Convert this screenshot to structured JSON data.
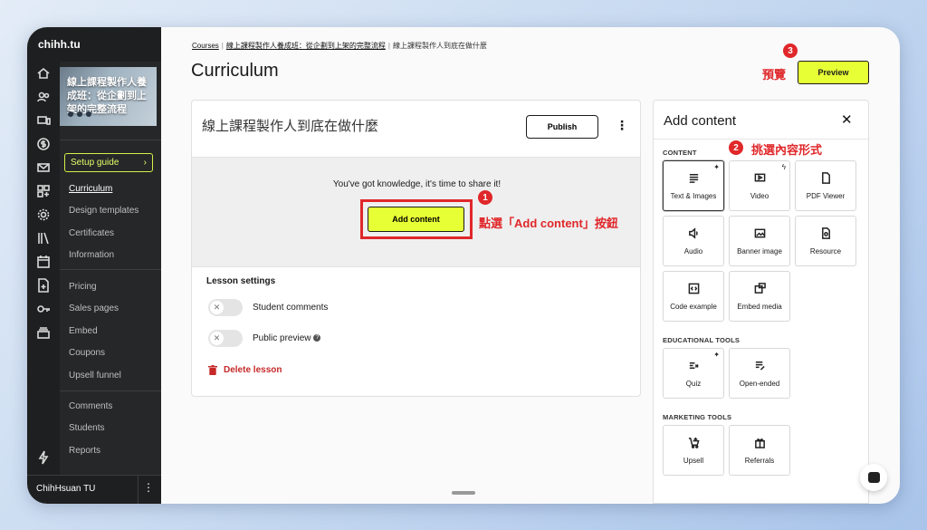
{
  "brand": "chihh.tu",
  "course_thumb_text": "線上課程製作人養成班：從企劃到上架的完整流程",
  "sidebar": {
    "setup_guide": "Setup guide",
    "group1": [
      "Curriculum",
      "Design templates",
      "Certificates",
      "Information"
    ],
    "group2": [
      "Pricing",
      "Sales pages",
      "Embed",
      "Coupons",
      "Upsell funnel"
    ],
    "group3": [
      "Comments",
      "Students",
      "Reports"
    ],
    "user_name": "ChihHsuan TU"
  },
  "breadcrumb": {
    "courses": "Courses",
    "course": "線上課程製作人養成班：從企劃到上架的完整流程",
    "lesson": "線上課程製作人到底在做什麼"
  },
  "page_title": "Curriculum",
  "annotations": {
    "step1_num": "1",
    "step1_text": "點選「Add content」按鈕",
    "step2_num": "2",
    "step2_text": "挑選內容形式",
    "step3_num": "3",
    "step3_text": "預覽"
  },
  "preview_label": "Preview",
  "lesson": {
    "title": "線上課程製作人到底在做什麼",
    "publish_label": "Publish",
    "kebab": "⋮",
    "share_text": "You've got knowledge, it's time to share it!",
    "add_content_label": "Add content",
    "settings_title": "Lesson settings",
    "student_comments": "Student comments",
    "public_preview": "Public preview",
    "delete_label": "Delete lesson"
  },
  "panel": {
    "title": "Add content",
    "close": "✕",
    "content_label": "CONTENT",
    "content_items": [
      "Text & Images",
      "Video",
      "PDF Viewer",
      "Audio",
      "Banner image",
      "Resource",
      "Code example",
      "Embed media"
    ],
    "edu_label": "EDUCATIONAL TOOLS",
    "edu_items": [
      "Quiz",
      "Open-ended"
    ],
    "marketing_label": "MARKETING TOOLS",
    "marketing_items": [
      "Upsell",
      "Referrals"
    ]
  },
  "colors": {
    "accent": "#e7ff35",
    "annotation_red": "#e0272a",
    "sidebar_bg": "#262728"
  }
}
